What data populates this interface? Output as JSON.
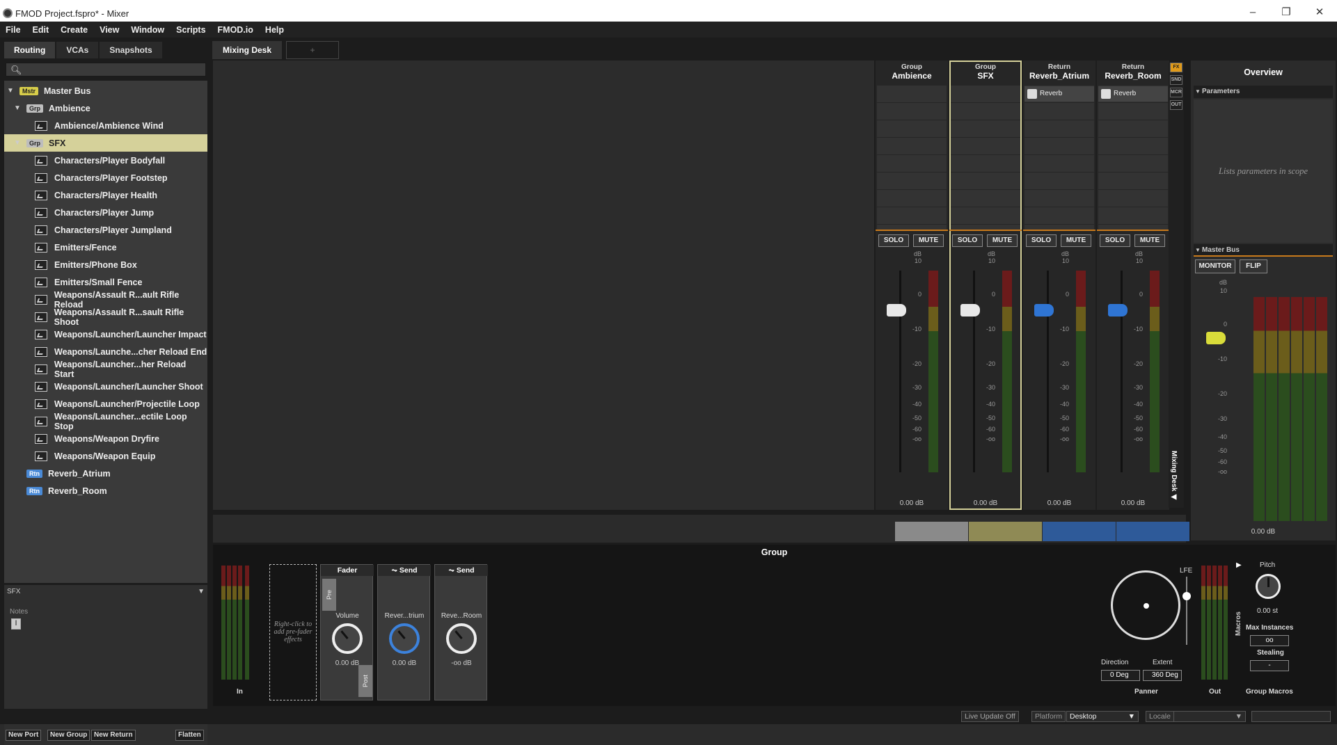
{
  "window": {
    "title": "FMOD Project.fspro* - Mixer",
    "min": "–",
    "max": "❐",
    "close": "✕"
  },
  "menu": [
    "File",
    "Edit",
    "Create",
    "View",
    "Window",
    "Scripts",
    "FMOD.io",
    "Help"
  ],
  "left_tabs": [
    "Routing",
    "VCAs",
    "Snapshots"
  ],
  "search": {
    "icon": "search-icon",
    "glyph": "🔍︎"
  },
  "tree": [
    {
      "type": "mstr",
      "tag": "Mstr",
      "label": "Master Bus",
      "indent": 0,
      "expanded": true
    },
    {
      "type": "grp",
      "tag": "Grp",
      "label": "Ambience",
      "indent": 1,
      "expanded": true
    },
    {
      "type": "ev",
      "label": "Ambience/Ambience Wind",
      "indent": 2
    },
    {
      "type": "grp",
      "tag": "Grp",
      "label": "SFX",
      "indent": 1,
      "expanded": true,
      "selected": true
    },
    {
      "type": "ev",
      "label": "Characters/Player Bodyfall",
      "indent": 2
    },
    {
      "type": "ev",
      "label": "Characters/Player Footstep",
      "indent": 2
    },
    {
      "type": "ev",
      "label": "Characters/Player Health",
      "indent": 2
    },
    {
      "type": "ev",
      "label": "Characters/Player Jump",
      "indent": 2
    },
    {
      "type": "ev",
      "label": "Characters/Player Jumpland",
      "indent": 2
    },
    {
      "type": "ev",
      "label": "Emitters/Fence",
      "indent": 2
    },
    {
      "type": "ev",
      "label": "Emitters/Phone Box",
      "indent": 2
    },
    {
      "type": "ev",
      "label": "Emitters/Small Fence",
      "indent": 2
    },
    {
      "type": "ev",
      "label": "Weapons/Assault R...ault Rifle Reload",
      "indent": 2
    },
    {
      "type": "ev",
      "label": "Weapons/Assault R...sault Rifle Shoot",
      "indent": 2
    },
    {
      "type": "ev",
      "label": "Weapons/Launcher/Launcher Impact",
      "indent": 2
    },
    {
      "type": "ev",
      "label": "Weapons/Launche...cher Reload End",
      "indent": 2
    },
    {
      "type": "ev",
      "label": "Weapons/Launcher...her Reload Start",
      "indent": 2
    },
    {
      "type": "ev",
      "label": "Weapons/Launcher/Launcher Shoot",
      "indent": 2
    },
    {
      "type": "ev",
      "label": "Weapons/Launcher/Projectile Loop",
      "indent": 2
    },
    {
      "type": "ev",
      "label": "Weapons/Launcher...ectile Loop Stop",
      "indent": 2
    },
    {
      "type": "ev",
      "label": "Weapons/Weapon Dryfire",
      "indent": 2
    },
    {
      "type": "ev",
      "label": "Weapons/Weapon Equip",
      "indent": 2
    },
    {
      "type": "rtn",
      "tag": "Rtn",
      "label": "Reverb_Atrium",
      "indent": 1
    },
    {
      "type": "rtn",
      "tag": "Rtn",
      "label": "Reverb_Room",
      "indent": 1
    }
  ],
  "notes": {
    "header": "SFX",
    "label": "Notes",
    "cursor": "I"
  },
  "left_buttons": [
    "New Port",
    "New Group",
    "New Return",
    "Flatten"
  ],
  "desk_tabs": {
    "active": "Mixing Desk",
    "add": "+"
  },
  "strips": [
    {
      "kind": "Group",
      "name": "Ambience",
      "fx": "",
      "knob": "white",
      "volume": "0.00 dB",
      "selected": false
    },
    {
      "kind": "Group",
      "name": "SFX",
      "fx": "",
      "knob": "white",
      "volume": "0.00 dB",
      "selected": true
    },
    {
      "kind": "Return",
      "name": "Reverb_Atrium",
      "fx": "Reverb",
      "knob": "blue",
      "volume": "0.00 dB",
      "selected": false
    },
    {
      "kind": "Return",
      "name": "Reverb_Room",
      "fx": "Reverb",
      "knob": "blue",
      "volume": "0.00 dB",
      "selected": false
    }
  ],
  "strip_buttons": {
    "solo": "SOLO",
    "mute": "MUTE"
  },
  "scale": [
    "dB",
    "10",
    "0",
    "-10",
    "-20",
    "-30",
    "-40",
    "-50",
    "-60",
    "-oo"
  ],
  "side_buttons": [
    "FX",
    "SND",
    "MCR",
    "OUT"
  ],
  "side_vertical": "Mixing Desk ◀",
  "overview": {
    "title": "Overview",
    "parameters_header": "Parameters",
    "parameters_hint": "Lists parameters in scope",
    "master_header": "Master Bus",
    "monitor": "MONITOR",
    "flip": "FLIP",
    "volume": "0.00 dB",
    "scale": [
      "dB",
      "10",
      "0",
      "-10",
      "-20",
      "-30",
      "-40",
      "-50",
      "-60",
      "-oo"
    ]
  },
  "mixbar_colors": [
    "#8a8a8a",
    "#8f8a55",
    "#2e5a99",
    "#2e5a99"
  ],
  "group_panel": {
    "title": "Group",
    "in": "In",
    "out": "Out",
    "pre_hint": "Right-click to add pre-fader effects",
    "fader": {
      "title": "Fader",
      "param": "Volume",
      "value": "0.00 dB",
      "pre": "Pre",
      "post": "Post"
    },
    "sends": [
      {
        "title": "Send",
        "param": "Rever...trium",
        "value": "0.00 dB"
      },
      {
        "title": "Send",
        "param": "Reve...Room",
        "value": "-oo dB"
      }
    ],
    "panner": {
      "label": "Panner",
      "direction_label": "Direction",
      "extent_label": "Extent",
      "direction": "0 Deg",
      "extent": "360 Deg",
      "lfe": "LFE"
    },
    "macros": {
      "label": "Group Macros",
      "vertical": "Macros",
      "pitch_label": "Pitch",
      "pitch": "0.00 st",
      "max_instances_label": "Max Instances",
      "max_instances": "oo",
      "stealing_label": "Stealing",
      "stealing": "-"
    }
  },
  "statusbar": {
    "live_update": "Live Update Off",
    "platform_label": "Platform",
    "platform": "Desktop",
    "locale_label": "Locale",
    "locale": ""
  }
}
